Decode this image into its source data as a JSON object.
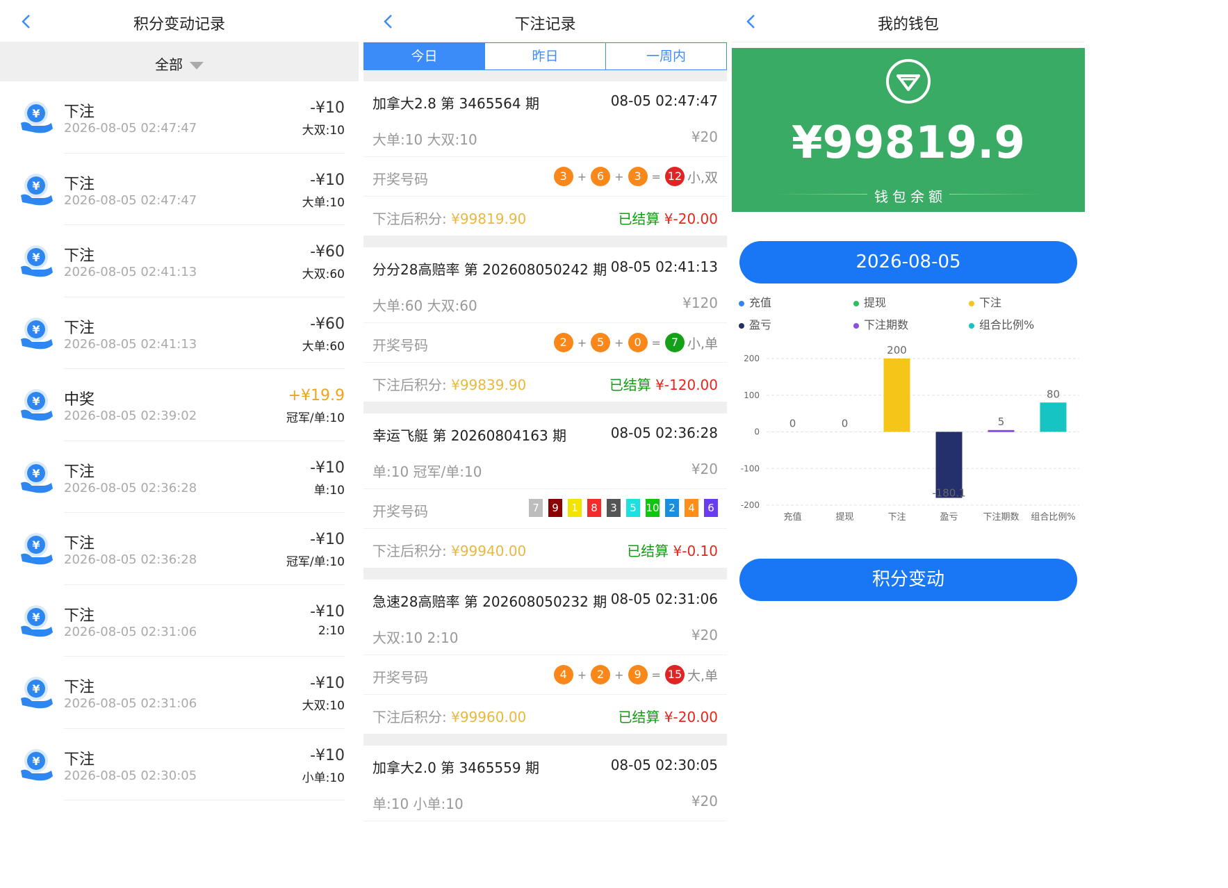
{
  "panel1": {
    "title": "积分变动记录",
    "filter": "全部",
    "records": [
      {
        "title": "下注",
        "time": "2026-08-05 02:47:47",
        "amount": "-¥10",
        "sub": "大双:10",
        "positive": false
      },
      {
        "title": "下注",
        "time": "2026-08-05 02:47:47",
        "amount": "-¥10",
        "sub": "大单:10",
        "positive": false
      },
      {
        "title": "下注",
        "time": "2026-08-05 02:41:13",
        "amount": "-¥60",
        "sub": "大双:60",
        "positive": false
      },
      {
        "title": "下注",
        "time": "2026-08-05 02:41:13",
        "amount": "-¥60",
        "sub": "大单:60",
        "positive": false
      },
      {
        "title": "中奖",
        "time": "2026-08-05 02:39:02",
        "amount": "+¥19.9",
        "sub": "冠军/单:10",
        "positive": true
      },
      {
        "title": "下注",
        "time": "2026-08-05 02:36:28",
        "amount": "-¥10",
        "sub": "单:10",
        "positive": false
      },
      {
        "title": "下注",
        "time": "2026-08-05 02:36:28",
        "amount": "-¥10",
        "sub": "冠军/单:10",
        "positive": false
      },
      {
        "title": "下注",
        "time": "2026-08-05 02:31:06",
        "amount": "-¥10",
        "sub": "2:10",
        "positive": false
      },
      {
        "title": "下注",
        "time": "2026-08-05 02:31:06",
        "amount": "-¥10",
        "sub": "大双:10",
        "positive": false
      },
      {
        "title": "下注",
        "time": "2026-08-05 02:30:05",
        "amount": "-¥10",
        "sub": "小单:10",
        "positive": false
      }
    ]
  },
  "panel2": {
    "title": "下注记录",
    "tabs": [
      "今日",
      "昨日",
      "一周内"
    ],
    "active_tab": 0,
    "draw_label": "开奖号码",
    "after_label": "下注后积分:",
    "settled_label": "已结算",
    "bets": [
      {
        "name": "加拿大2.8 第 3465564 期",
        "time": "08-05 02:47:47",
        "detail": "大单:10 大双:10",
        "stake": "¥20",
        "draw": {
          "type": "sum",
          "nums": [
            "3",
            "6",
            "3"
          ],
          "total": "12",
          "total_color": "#e02424",
          "result": "小,双"
        },
        "after": "¥99819.90",
        "settle": "¥-20.00"
      },
      {
        "name": "分分28高赔率 第 202608050242 期",
        "time": "08-05 02:41:13",
        "detail": "大单:60 大双:60",
        "stake": "¥120",
        "draw": {
          "type": "sum",
          "nums": [
            "2",
            "5",
            "0"
          ],
          "total": "7",
          "total_color": "#15a01a",
          "result": "小,单"
        },
        "after": "¥99839.90",
        "settle": "¥-120.00"
      },
      {
        "name": "幸运飞艇 第 20260804163 期",
        "time": "08-05 02:36:28",
        "detail": "单:10 冠军/单:10",
        "stake": "¥20",
        "draw": {
          "type": "squares",
          "nums": [
            "7",
            "9",
            "1",
            "8",
            "3",
            "5",
            "10",
            "2",
            "4",
            "6"
          ],
          "colors": [
            "#bdbdbd",
            "#8b0000",
            "#f2e300",
            "#f22b2b",
            "#555555",
            "#1fe0e0",
            "#10c410",
            "#1a8ee0",
            "#ff8d1a",
            "#6a3cf0"
          ]
        },
        "after": "¥99940.00",
        "settle": "¥-0.10"
      },
      {
        "name": "急速28高赔率 第 202608050232 期",
        "time": "08-05 02:31:06",
        "detail": "大双:10 2:10",
        "stake": "¥20",
        "draw": {
          "type": "sum",
          "nums": [
            "4",
            "2",
            "9"
          ],
          "total": "15",
          "total_color": "#e02424",
          "result": "大,单"
        },
        "after": "¥99960.00",
        "settle": "¥-20.00"
      },
      {
        "name": "加拿大2.0 第 3465559 期",
        "time": "08-05 02:30:05",
        "detail": "单:10 小单:10",
        "stake": "¥20"
      }
    ]
  },
  "panel3": {
    "title": "我的钱包",
    "balance": "¥99819.9",
    "balance_label": "钱包余额",
    "date": "2026-08-05",
    "action": "积分变动",
    "colors": {
      "wallet_bg": "#3aab64",
      "button": "#1976f5"
    }
  },
  "chart_data": {
    "type": "bar",
    "categories": [
      "充值",
      "提现",
      "下注",
      "盈亏",
      "下注期数",
      "组合比例%"
    ],
    "values": [
      0,
      0,
      200,
      -180.1,
      5,
      80
    ],
    "value_labels": [
      "0",
      "0",
      "200",
      "-180.1",
      "5",
      "80"
    ],
    "colors": [
      "#2e86f0",
      "#2bbf5a",
      "#f5c518",
      "#23306b",
      "#8a4fe0",
      "#17c4c4"
    ],
    "legend": [
      "充值",
      "提现",
      "下注",
      "盈亏",
      "下注期数",
      "组合比例%"
    ],
    "legend_position": "top",
    "ylim": [
      -200,
      200
    ],
    "yticks": [
      "200",
      "100",
      "0",
      "-100",
      "-200"
    ],
    "grid": true
  }
}
